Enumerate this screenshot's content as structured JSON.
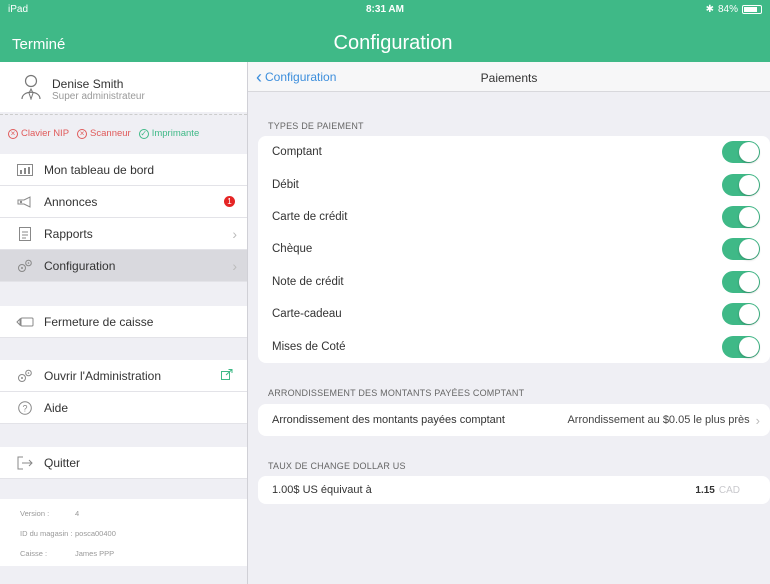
{
  "status": {
    "device": "iPad",
    "time": "8:31 AM",
    "bluetooth": "✱",
    "battery": "84%",
    "battery_level": 0.84
  },
  "nav": {
    "done_label": "Terminé",
    "title": "Configuration"
  },
  "sidebar": {
    "user_name": "Denise Smith",
    "user_role": "Super administrateur",
    "devices": [
      {
        "label": "Clavier NIP",
        "state": "off"
      },
      {
        "label": "Scanneur",
        "state": "off"
      },
      {
        "label": "Imprimante",
        "state": "on"
      }
    ],
    "items": [
      {
        "label": "Mon tableau de bord",
        "icon": "dashboard-icon"
      },
      {
        "label": "Annonces",
        "icon": "megaphone-icon",
        "badge": "1"
      },
      {
        "label": "Rapports",
        "icon": "document-icon"
      },
      {
        "label": "Configuration",
        "icon": "gears-icon"
      },
      {
        "label": "Fermeture de caisse",
        "icon": "register-icon"
      },
      {
        "label": "Ouvrir l'Administration",
        "icon": "gears-icon"
      },
      {
        "label": "Aide",
        "icon": "help-icon"
      },
      {
        "label": "Quitter",
        "icon": "exit-icon"
      }
    ],
    "version": {
      "version_label": "Version :",
      "version_value": "4",
      "store_label": "ID du magasin :",
      "store_value": "posca00400",
      "register_label": "Caisse :",
      "register_value": "James PPP"
    }
  },
  "main": {
    "back_label": "Configuration",
    "title": "Paiements",
    "payment_types_header": "TYPES DE PAIEMENT",
    "payment_types": [
      {
        "label": "Comptant",
        "enabled": true
      },
      {
        "label": "Débit",
        "enabled": true
      },
      {
        "label": "Carte de crédit",
        "enabled": true
      },
      {
        "label": "Chèque",
        "enabled": true
      },
      {
        "label": "Note de crédit",
        "enabled": true
      },
      {
        "label": "Carte-cadeau",
        "enabled": true
      },
      {
        "label": "Mises de Coté",
        "enabled": true
      }
    ],
    "rounding_header": "ARRONDISSEMENT DES MONTANTS PAYÉES COMPTANT",
    "rounding_label": "Arrondissement des montants payées comptant",
    "rounding_value": "Arrondissement au $0.05 le plus près",
    "fx_header": "TAUX DE CHANGE DOLLAR US",
    "fx_label": "1.00$ US équivaut à",
    "fx_value": "1.15",
    "fx_currency": "CAD"
  },
  "colors": {
    "accent": "#3fb987",
    "link": "#3c8edc",
    "badge": "#e52525",
    "error": "#e05a5a"
  }
}
